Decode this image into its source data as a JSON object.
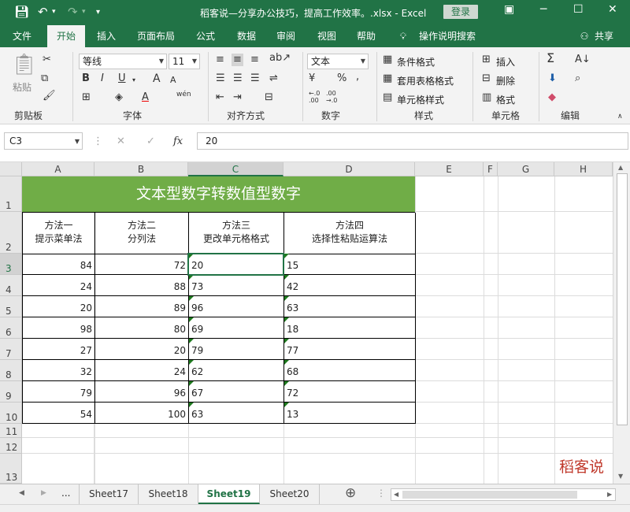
{
  "window": {
    "title": "稻客说—分享办公技巧，提高工作效率。.xlsx  -  Excel",
    "login_label": "登录",
    "quick_access": [
      "save-icon",
      "undo-icon",
      "redo-icon",
      "customize-icon"
    ]
  },
  "tabs": [
    {
      "label": "文件"
    },
    {
      "label": "开始",
      "active": true
    },
    {
      "label": "插入"
    },
    {
      "label": "页面布局"
    },
    {
      "label": "公式"
    },
    {
      "label": "数据"
    },
    {
      "label": "审阅"
    },
    {
      "label": "视图"
    },
    {
      "label": "帮助"
    }
  ],
  "tell_me": "操作说明搜索",
  "share": "共享",
  "ribbon": {
    "clipboard": {
      "label": "剪贴板",
      "paste": "粘贴"
    },
    "font": {
      "label": "字体",
      "name": "等线",
      "size": "11",
      "bold": "B",
      "italic": "I",
      "underline": "U",
      "grow": "A",
      "shrink": "A",
      "pinyin": "wén"
    },
    "alignment": {
      "label": "对齐方式"
    },
    "number": {
      "label": "数字",
      "format": "文本",
      "percent": "%",
      "comma": ",",
      "inc": "←.0 .00",
      "dec": ".00 →.0"
    },
    "styles": {
      "label": "样式",
      "cond": "条件格式",
      "table": "套用表格格式",
      "cell": "单元格样式"
    },
    "cells": {
      "label": "单元格",
      "insert": "插入",
      "delete": "删除",
      "format": "格式"
    },
    "editing": {
      "label": "编辑",
      "sum": "Σ",
      "sort": "A↓",
      "find": "⌕"
    }
  },
  "formula_bar": {
    "name_box": "C3",
    "value": "20",
    "fx": "fx"
  },
  "columns": [
    "A",
    "B",
    "C",
    "D",
    "E",
    "F",
    "G",
    "H"
  ],
  "rows": [
    "1",
    "2",
    "3",
    "4",
    "5",
    "6",
    "7",
    "8",
    "9",
    "10",
    "11",
    "12",
    "13"
  ],
  "sheet": {
    "title": "文本型数字转数值型数字",
    "headers": [
      [
        "方法一",
        "提示菜单法"
      ],
      [
        "方法二",
        "分列法"
      ],
      [
        "方法三",
        "更改单元格格式"
      ],
      [
        "方法四",
        "选择性粘贴运算法"
      ]
    ],
    "data": [
      [
        "84",
        "72",
        "20",
        "15"
      ],
      [
        "24",
        "88",
        "73",
        "42"
      ],
      [
        "20",
        "89",
        "96",
        "63"
      ],
      [
        "98",
        "80",
        "69",
        "18"
      ],
      [
        "27",
        "20",
        "79",
        "77"
      ],
      [
        "32",
        "24",
        "62",
        "68"
      ],
      [
        "79",
        "96",
        "67",
        "72"
      ],
      [
        "54",
        "100",
        "63",
        "13"
      ]
    ],
    "watermark": "稻客说"
  },
  "sheet_tabs": {
    "ellipsis": "...",
    "tabs": [
      {
        "label": "Sheet17"
      },
      {
        "label": "Sheet18"
      },
      {
        "label": "Sheet19",
        "active": true
      },
      {
        "label": "Sheet20"
      }
    ]
  },
  "colors": {
    "excel_green": "#217346",
    "title_bg": "#70ad47",
    "error_triangle": "#1e7a1e",
    "watermark": "#c0392b"
  }
}
